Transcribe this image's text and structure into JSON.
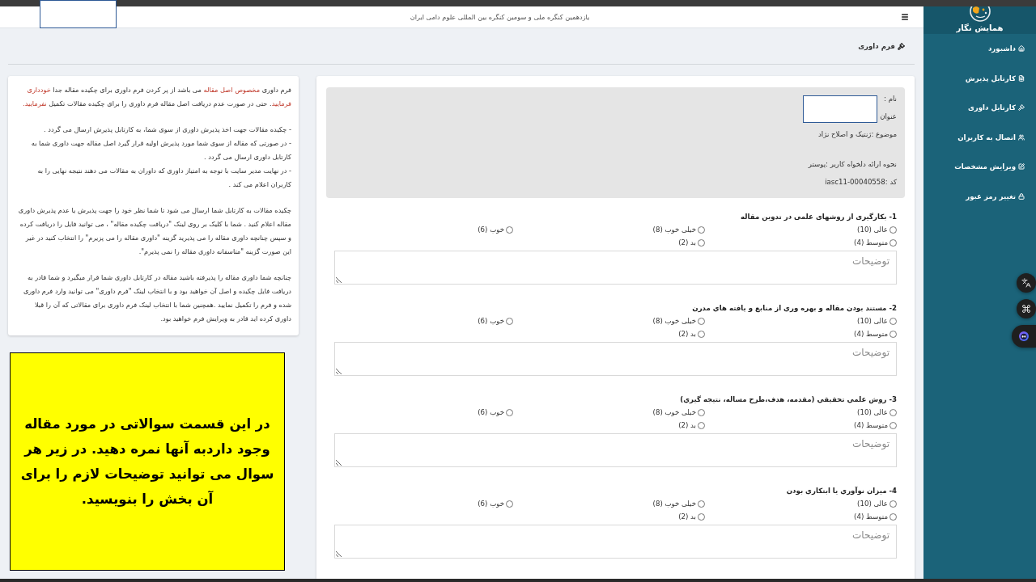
{
  "header": {
    "title": "یازدهمین کنگره ملی و سومین کنگره بین المللی علوم دامی ایران"
  },
  "sidebar": {
    "logo_text": "همایش نگار",
    "items": [
      {
        "label": "داشبورد",
        "selected": false
      },
      {
        "label": "کارتابل پذیرش",
        "selected": false
      },
      {
        "label": "کارتابل داوری",
        "selected": false
      },
      {
        "label": "اتصال به کاربران",
        "selected": false
      },
      {
        "label": "ویرایش مشخصات",
        "selected": false
      },
      {
        "label": "تغییر رمز عبور",
        "selected": false
      }
    ]
  },
  "breadcrumb": {
    "label": "فرم داوری"
  },
  "info_panel": {
    "paragraphs": [
      {
        "lines": [
          [
            {
              "text": "فرم داوری ",
              "highlight": false
            },
            {
              "text": "مخصوص اصل مقاله",
              "highlight": true
            },
            {
              "text": " می باشد از پر کردن فرم داوری برای چکیده مقاله جدا ",
              "highlight": false
            },
            {
              "text": "خودداری فرمایید",
              "highlight": true
            },
            {
              "text": ". حتی در صورت عدم دریافت اصل مقاله فرم داوری را برای چکیده مقالات تکمیل ",
              "highlight": false
            },
            {
              "text": "نفرمایید.",
              "highlight": true
            }
          ]
        ]
      },
      {
        "lines": [
          [
            {
              "text": "- چکیده مقالات جهت اخذ پذیرش داوری از سوی شما، به کارتابل پذیرش ارسال می گردد .",
              "highlight": false
            }
          ],
          [
            {
              "text": "- در صورتی که مقاله از سوی شما مورد پذیرش اولیه قرار گیرد اصل مقاله جهت داوری شما به کارتابل داوری ارسال می گردد .",
              "highlight": false
            }
          ],
          [
            {
              "text": "- در نهایت مدیر سایت با توجه به امتیاز داوری که داوران به مقالات می دهند نتیجه نهایی را به کاربران اعلام می کند .",
              "highlight": false
            }
          ]
        ]
      },
      {
        "lines": [
          [
            {
              "text": "چکیده مقالات به کارتابل شما ارسال می شود تا شما نظر خود را جهت پذیرش یا عدم پذیرش داوری مقاله اعلام کنید . شما با کلیک بر روی لینک \"دریافت چکیده مقاله\" ، می توانید فایل را دریافت کرده و سپس چنانچه داوری مقاله را می پذیرید گزینه \"داوری مقاله را می پزیرم\" را انتخاب کنید در غیر این صورت گزینه \"متاسفانه داوری مقاله را نمی پذیرم\".",
              "highlight": false
            }
          ]
        ]
      },
      {
        "lines": [
          [
            {
              "text": "چنانچه شما داوری مقاله را پذیرفته باشید مقاله در کارتابل داوری شما قرار میگیرد و شما قادر به دریافت فایل چکیده و اصل آن خواهید بود و با انتخاب لینک \"فرم داوری\" می توانید وارد فرم داوری شده و فرم را تکمیل نمایید .همچنین شما با انتخاب لینک فرم داوری برای مقالاتی که آن را قبلا داوری کرده اید قادر به ویرایش فرم خواهید بود.",
              "highlight": false
            }
          ]
        ]
      }
    ]
  },
  "callout": {
    "text": "در این قسمت سوالاتی در مورد مقاله وجود داردبه آنها نمره دهید. در زیر هر سوال می توانید توضیحات لازم را برای آن بخش را بنویسید."
  },
  "submission": {
    "groups": [
      [
        "نام :",
        "عنوان",
        "موضوع :ژنتیک و اصلاح نژاد"
      ],
      [
        "نحوه ارائه دلخواه کاربر :پوستر",
        "کد :iasc11-00040558"
      ]
    ]
  },
  "questions": [
    {
      "title": "1- بکارگیری از روشهای علمی در تدوین مقاله",
      "options": [
        {
          "label": "عالی (10)",
          "selected": false
        },
        {
          "label": "خیلی خوب (8)",
          "selected": false
        },
        {
          "label": "خوب (6)",
          "selected": false
        },
        {
          "label": "متوسط (4)",
          "selected": false
        },
        {
          "label": "بد (2)",
          "selected": false
        }
      ],
      "comment": {
        "placeholder": "توضیحات"
      }
    },
    {
      "title": "2- مستند بودن مقاله و بهره وري از منابع و يافته هاي مدرن",
      "options": [
        {
          "label": "عالی (10)",
          "selected": false
        },
        {
          "label": "خیلی خوب (8)",
          "selected": false
        },
        {
          "label": "خوب (6)",
          "selected": false
        },
        {
          "label": "متوسط (4)",
          "selected": false
        },
        {
          "label": "بد (2)",
          "selected": false
        }
      ],
      "comment": {
        "placeholder": "توضیحات"
      }
    },
    {
      "title": "3- روش علمي تحقيقي (مقدمه، هدف،طرح مساله، نتيجه گيري)",
      "options": [
        {
          "label": "عالی (10)",
          "selected": false
        },
        {
          "label": "خیلی خوب (8)",
          "selected": false
        },
        {
          "label": "خوب (6)",
          "selected": false
        },
        {
          "label": "متوسط (4)",
          "selected": false
        },
        {
          "label": "بد (2)",
          "selected": false
        }
      ],
      "comment": {
        "placeholder": "توضیحات"
      }
    },
    {
      "title": "4- ميزان نوآوري يا ابتکاري بودن",
      "options": [
        {
          "label": "عالی (10)",
          "selected": false
        },
        {
          "label": "خیلی خوب (8)",
          "selected": false
        },
        {
          "label": "خوب (6)",
          "selected": false
        },
        {
          "label": "متوسط (4)",
          "selected": false
        },
        {
          "label": "بد (2)",
          "selected": false
        }
      ],
      "comment": {
        "placeholder": "توضیحات"
      }
    }
  ]
}
